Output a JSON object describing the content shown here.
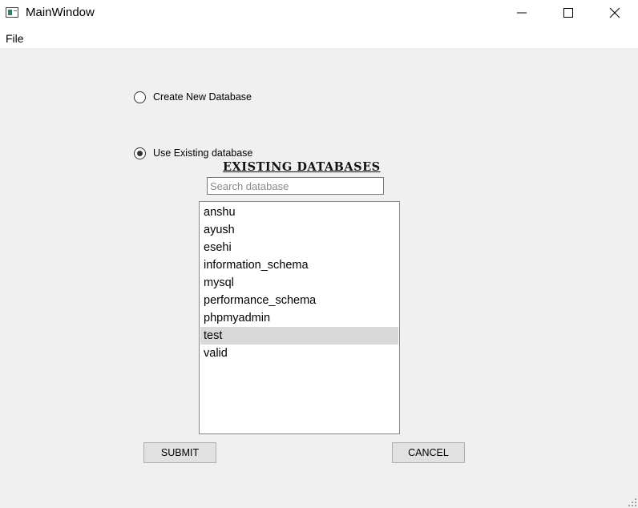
{
  "window": {
    "title": "MainWindow",
    "controls": [
      "minimize-icon",
      "maximize-icon",
      "close-icon"
    ]
  },
  "menubar": {
    "items": [
      {
        "label": "File"
      }
    ]
  },
  "options": {
    "create_new": {
      "label": "Create New Database",
      "checked": false
    },
    "use_existing": {
      "label": "Use Existing database",
      "checked": true
    }
  },
  "existing": {
    "heading": "EXISTING DATABASES",
    "search_placeholder": "Search database",
    "search_value": "",
    "databases": [
      {
        "label": "anshu",
        "selected": false
      },
      {
        "label": "ayush",
        "selected": false
      },
      {
        "label": "esehi",
        "selected": false
      },
      {
        "label": "information_schema",
        "selected": false
      },
      {
        "label": "mysql",
        "selected": false
      },
      {
        "label": "performance_schema",
        "selected": false
      },
      {
        "label": "phpmyadmin",
        "selected": false
      },
      {
        "label": "test",
        "selected": true
      },
      {
        "label": "valid",
        "selected": false
      }
    ]
  },
  "buttons": {
    "submit": "SUBMIT",
    "cancel": "CANCEL"
  },
  "colors": {
    "selection": "#d9d9d9",
    "background": "#f0f0f0",
    "button": "#e1e1e1"
  }
}
